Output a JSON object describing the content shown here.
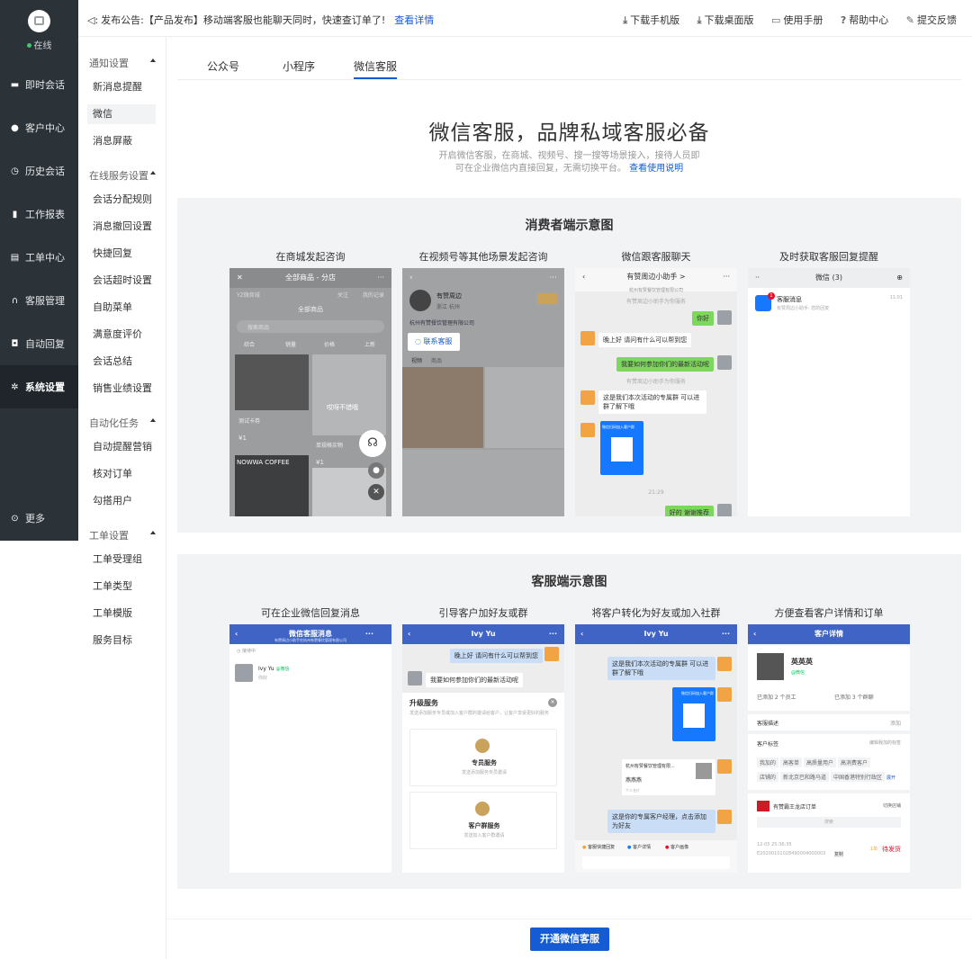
{
  "nav": {
    "status": "在线",
    "items": [
      {
        "label": "即时会话",
        "icon": "chat-icon"
      },
      {
        "label": "客户中心",
        "icon": "user-icon"
      },
      {
        "label": "历史会话",
        "icon": "clock-icon"
      },
      {
        "label": "工作报表",
        "icon": "bar-chart-icon"
      },
      {
        "label": "工单中心",
        "icon": "ticket-icon"
      },
      {
        "label": "客服管理",
        "icon": "headset-icon"
      },
      {
        "label": "自动回复",
        "icon": "robot-icon"
      },
      {
        "label": "系统设置",
        "icon": "gear-icon"
      },
      {
        "label": "更多",
        "icon": "more-icon"
      }
    ]
  },
  "menu": {
    "groups": [
      {
        "label": "通知设置",
        "items": [
          "新消息提醒",
          "微信",
          "消息屏蔽"
        ]
      },
      {
        "label": "在线服务设置",
        "items": [
          "会话分配规则",
          "消息撤回设置",
          "快捷回复",
          "会话超时设置",
          "自助菜单",
          "满意度评价",
          "会话总结",
          "销售业绩设置"
        ]
      },
      {
        "label": "自动化任务",
        "items": [
          "自动提醒营销",
          "核对订单",
          "勾搭用户"
        ]
      },
      {
        "label": "工单设置",
        "items": [
          "工单受理组",
          "工单类型",
          "工单模版",
          "服务目标"
        ]
      }
    ]
  },
  "topbar": {
    "announcement": "发布公告:【产品发布】移动端客服也能聊天同时，快速查订单了!",
    "announcement_link": "查看详情",
    "links": [
      "下载手机版",
      "下载桌面版",
      "使用手册",
      "帮助中心",
      "提交反馈"
    ]
  },
  "tabs": [
    "公众号",
    "小程序",
    "微信客服"
  ],
  "hero": {
    "title": "微信客服，品牌私域客服必备",
    "line1": "开启微信客服，在商城、视频号、搜一搜等场景接入，接待人员即",
    "line2": "可在企业微信内直接回复，无需切换平台。",
    "link": "查看使用说明"
  },
  "consumer": {
    "title": "消费者端示意图",
    "captions": [
      "在商城发起咨询",
      "在视频号等其他场景发起咨询",
      "微信跟客服聊天",
      "及时获取客服回复提醒"
    ],
    "shot1": {
      "header": "全部商品 - 分店",
      "store": "YZ微商城",
      "follow": "关注",
      "records": "我的记录",
      "all": "全部商品",
      "search": "搜索商品",
      "sorts": [
        "综合",
        "销量",
        "价格",
        "上新"
      ],
      "item1": "测试卡券",
      "price1": "¥1",
      "item2": "单规格实物",
      "price2": "¥1",
      "sticker": "NOWWA COFFEE",
      "overlay": "哎呀不错哦"
    },
    "shot2": {
      "name": "有赞周边",
      "location": "浙江 杭州",
      "company": "杭州有赞餐饮管理有限公司",
      "contact": "联系客服",
      "tabs": [
        "视频",
        "商品"
      ]
    },
    "shot3": {
      "header": "有赞周边小助手 >",
      "sub": "杭州有赞餐饮管理有限公司",
      "note": "有赞周边小助手为你服务",
      "msgs": [
        "你好",
        "晚上好 请问有什么可以帮到您",
        "我要如何参加你们的最新活动呢",
        "这是我们本次活动的专属群 可以进群了解下哦",
        "好的 谢谢推荐"
      ],
      "time": "21:29",
      "qr_label": "微信扫码加入客户群"
    },
    "shot4": {
      "header": "微信 (3)",
      "item": "客服消息",
      "preview": "有赞周边小助手: 您的回复",
      "time": "11:01",
      "badge": "1"
    }
  },
  "agent": {
    "title": "客服端示意图",
    "captions": [
      "可在企业微信回复消息",
      "引导客户加好友或群",
      "将客户转化为好友或加入社群",
      "方便查看客户详情和订单"
    ],
    "shot1": {
      "header": "微信客服消息",
      "sub": "有赞周边小助手在杭州有赞餐饮管理有限公司",
      "search": "接待中",
      "name": "Ivy Yu",
      "tag": "@微信",
      "preview": "你好"
    },
    "shot2": {
      "header": "Ivy Yu",
      "sub": "@微信",
      "msg1": "晚上好 请问有什么可以帮到您",
      "msg2": "我要如何参加你们的最新活动呢",
      "section": "升级服务",
      "desc": "发送添加服务专员或加入客户群的邀请给客户，让客户享受更好的服务",
      "opt1": "专员服务",
      "opt1_sub": "发送添加服务专员邀请",
      "opt2": "客户群服务",
      "opt2_sub": "发送加入客户群邀请"
    },
    "shot3": {
      "header": "Ivy Yu",
      "msg1": "这是我们本次活动的专属群 可以进群了解下哦",
      "card_title": "杭州有赞餐饮管理有限...",
      "card_name": "燕燕燕",
      "card_sub": "个人名片",
      "msg2": "这是你的专属客户经理，点击添加为好友",
      "qr_label": "微信扫码加入客户群",
      "actions": [
        "客服快捷回复",
        "客户详情",
        "客户画像"
      ]
    },
    "shot4": {
      "header": "客户详情",
      "name": "英英英",
      "tag": "@微信",
      "added": "已添加 2 个员工",
      "groups": "已添加 3 个群聊",
      "desc": "客服描述",
      "add": "添加",
      "labels": "客户标签",
      "edit": "编辑我加的标签",
      "row1": [
        "我加的",
        "高客单",
        "高质量用户",
        "高消费客户"
      ],
      "row2": [
        "店铺的",
        "新北京巴和路马道",
        "中国香港特别行政区"
      ],
      "expand": "展开",
      "store": "有赞霸王龙店订单",
      "switch": "切换店铺",
      "search": "搜索",
      "date": "12-05 25:36:35",
      "order": "E20200101028490004000003",
      "copy": "复制",
      "amount": "1单",
      "status": "待发货"
    }
  },
  "cta": "开通微信客服"
}
